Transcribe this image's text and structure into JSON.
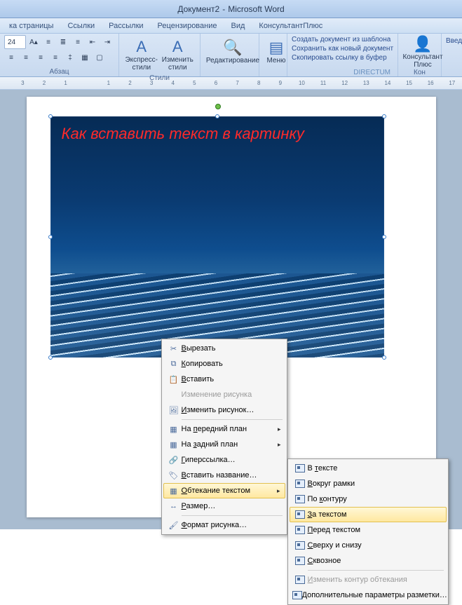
{
  "title": {
    "doc": "Документ2",
    "sep": "-",
    "app": "Microsoft Word"
  },
  "menubar": [
    "ка страницы",
    "Ссылки",
    "Рассылки",
    "Рецензирование",
    "Вид",
    "КонсультантПлюс"
  ],
  "ribbon": {
    "font_size": "24",
    "para_group": "Абзац",
    "styles": {
      "express": "Экспресс-стили",
      "change": "Изменить стили",
      "label": "Стили"
    },
    "edit_group": "Редактирование",
    "menu_btn": "Меню",
    "links": [
      "Создать документ из шаблона",
      "Сохранить как новый документ",
      "Скопировать ссылку в буфер"
    ],
    "directum": "DIRECTUM",
    "consult": {
      "name": "Консультант Плюс",
      "right": "Введит",
      "group": "Кон"
    }
  },
  "ruler": [
    3,
    2,
    1,
    "",
    1,
    2,
    3,
    4,
    5,
    6,
    7,
    8,
    9,
    10,
    11,
    12,
    13,
    14,
    15,
    16,
    17
  ],
  "image_text": "Как вставить текст в картинку",
  "context_menu": [
    {
      "icon": "cut-icon",
      "label": "Вырезать",
      "u": "В"
    },
    {
      "icon": "copy-icon",
      "label": "Копировать",
      "u": "К"
    },
    {
      "icon": "paste-icon",
      "label": "Вставить",
      "u": "В"
    },
    {
      "icon": "",
      "label": "Изменение рисунка",
      "disabled": true
    },
    {
      "icon": "edit-pic-icon",
      "label": "Изменить рисунок…",
      "u": "И"
    },
    {
      "sep": true
    },
    {
      "icon": "front-icon",
      "label": "На передний план",
      "arrow": true,
      "u": "п"
    },
    {
      "icon": "back-icon",
      "label": "На задний план",
      "arrow": true,
      "u": "з"
    },
    {
      "icon": "link-icon",
      "label": "Гиперссылка…",
      "u": "Г"
    },
    {
      "icon": "caption-icon",
      "label": "Вставить название…",
      "u": "В"
    },
    {
      "icon": "wrap-icon",
      "label": "Обтекание текстом",
      "arrow": true,
      "hl": true,
      "u": "О"
    },
    {
      "icon": "size-icon",
      "label": "Размер…",
      "u": "Р"
    },
    {
      "sep": true
    },
    {
      "icon": "format-icon",
      "label": "Формат рисунка…",
      "u": "Ф"
    }
  ],
  "submenu": [
    {
      "label": "В тексте",
      "u": "т"
    },
    {
      "label": "Вокруг рамки",
      "u": "В"
    },
    {
      "label": "По контуру",
      "u": "к"
    },
    {
      "label": "За текстом",
      "u": "З",
      "hl": true
    },
    {
      "label": "Перед текстом",
      "u": "П"
    },
    {
      "label": "Сверху и снизу",
      "u": "С"
    },
    {
      "label": "Сквозное",
      "u": "С"
    },
    {
      "sep": true
    },
    {
      "label": "Изменить контур обтекания",
      "disabled": true,
      "u": "И"
    },
    {
      "label": "Дополнительные параметры разметки…",
      "u": "Д"
    }
  ]
}
